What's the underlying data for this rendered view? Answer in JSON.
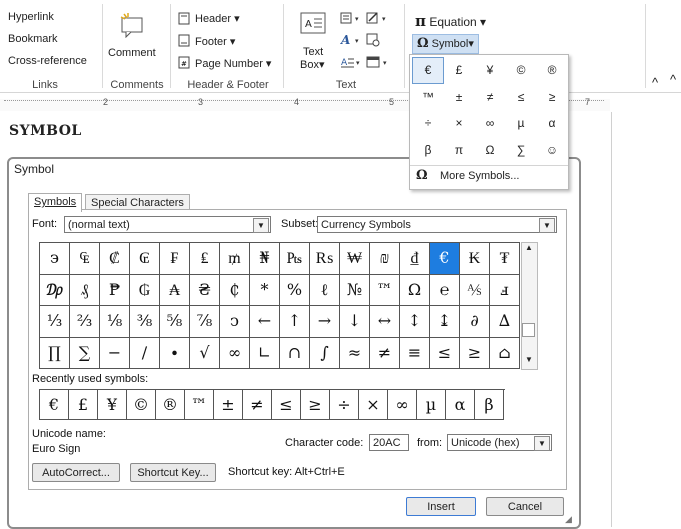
{
  "ribbon": {
    "links": {
      "items": [
        "Hyperlink",
        "Bookmark",
        "Cross-reference"
      ],
      "label": "Links"
    },
    "comments": {
      "button": "Comment",
      "label": "Comments"
    },
    "header_footer": {
      "items": [
        "Header",
        "Footer",
        "Page Number"
      ],
      "label": "Header & Footer"
    },
    "text": {
      "textbox": "Text",
      "textbox2": "Box",
      "label": "Text"
    },
    "symbols": {
      "equation": "Equation",
      "symbol": "Symbol"
    }
  },
  "ruler": {
    "marks": [
      "2",
      "3",
      "4",
      "5",
      "7"
    ]
  },
  "document": {
    "heading": "SYMBOL"
  },
  "gallery": {
    "symbols": [
      "€",
      "£",
      "¥",
      "©",
      "®",
      "™",
      "±",
      "≠",
      "≤",
      "≥",
      "÷",
      "×",
      "∞",
      "µ",
      "α",
      "β",
      "π",
      "Ω",
      "∑",
      "☺"
    ],
    "more_icon": "Ω",
    "more_label": "More Symbols..."
  },
  "dialog": {
    "title": "Symbol",
    "tabs": [
      "Symbols",
      "Special Characters"
    ],
    "font_label": "Font:",
    "font_value": "(normal text)",
    "subset_label": "Subset:",
    "subset_value": "Currency Symbols",
    "grid": [
      [
        "϶",
        "₠",
        "₡",
        "₢",
        "₣",
        "₤",
        "₥",
        "₦",
        "₧",
        "₨",
        "₩",
        "₪",
        "₫",
        "€",
        "₭",
        "₮"
      ],
      [
        "₯",
        "₰",
        "₱",
        "₲",
        "₳",
        "₴",
        "₵",
        "*",
        "%",
        "ℓ",
        "№",
        "™",
        "Ω",
        "℮",
        "⅍",
        "ⅎ"
      ],
      [
        "⅓",
        "⅔",
        "⅛",
        "⅜",
        "⅝",
        "⅞",
        "ↄ",
        "←",
        "↑",
        "→",
        "↓",
        "↔",
        "↕",
        "↨",
        "∂",
        "∆"
      ],
      [
        "∏",
        "∑",
        "−",
        "∕",
        "∙",
        "√",
        "∞",
        "∟",
        "∩",
        "∫",
        "≈",
        "≠",
        "≡",
        "≤",
        "≥",
        "⌂"
      ]
    ],
    "selected": {
      "row": 0,
      "col": 13
    },
    "recent_label": "Recently used symbols:",
    "recent": [
      "€",
      "£",
      "¥",
      "©",
      "®",
      "™",
      "±",
      "≠",
      "≤",
      "≥",
      "÷",
      "×",
      "∞",
      "µ",
      "α",
      "β"
    ],
    "unicode_name_label": "Unicode name:",
    "unicode_name_value": "Euro Sign",
    "char_code_label": "Character code:",
    "char_code_value": "20AC",
    "from_label": "from:",
    "from_value": "Unicode (hex)",
    "autocorrect_button": "AutoCorrect...",
    "shortcut_key_button": "Shortcut Key...",
    "shortcut_text": "Shortcut key: Alt+Ctrl+E",
    "insert_button": "Insert",
    "cancel_button": "Cancel"
  },
  "colors": {
    "selection": "#1e7de0",
    "accent": "#2b579a"
  }
}
